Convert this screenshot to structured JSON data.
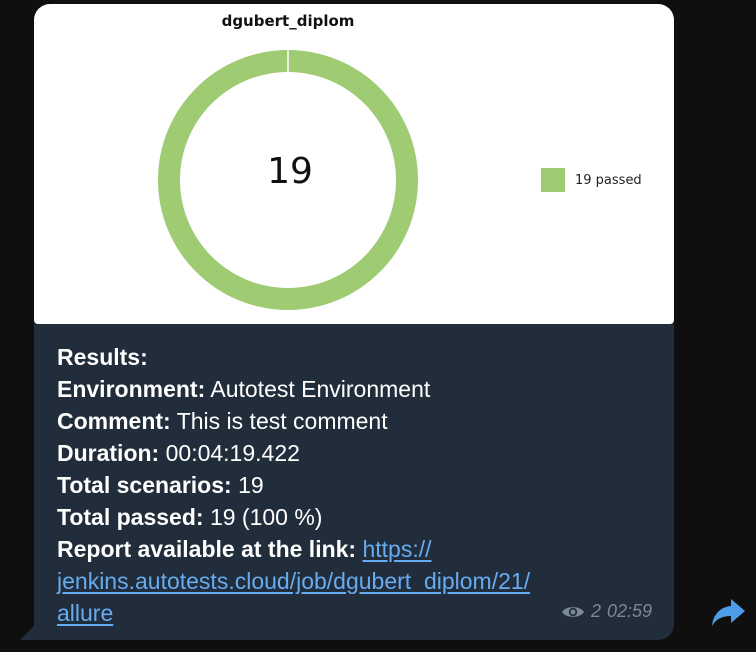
{
  "chart_data": {
    "type": "pie",
    "title": "dgubert_diplom",
    "center_label": "19",
    "categories": [
      "passed"
    ],
    "values": [
      19
    ],
    "legend": [
      "19 passed"
    ],
    "legend_position": "right",
    "colors": [
      "#9fcc73"
    ]
  },
  "message": {
    "results_label": "Results:",
    "environment_label": "Environment:",
    "environment_value": "Autotest Environment",
    "comment_label": "Comment:",
    "comment_value": "This is test comment",
    "duration_label": "Duration:",
    "duration_value": "00:04:19.422",
    "total_scenarios_label": "Total scenarios:",
    "total_scenarios_value": "19",
    "total_passed_label": "Total passed:",
    "total_passed_value": "19 (100 %)",
    "report_label": "Report available at the link:",
    "link_line1": "https://",
    "link_line2": "jenkins.autotests.cloud/job/dgubert_diplom/21/",
    "link_line3": "allure",
    "views": "2",
    "time": "02:59"
  },
  "icons": {
    "views": "eye-icon",
    "share": "share-arrow-icon"
  },
  "colors": {
    "bubble": "#212d3b",
    "link": "#67abf0",
    "passed": "#9fcc73"
  }
}
